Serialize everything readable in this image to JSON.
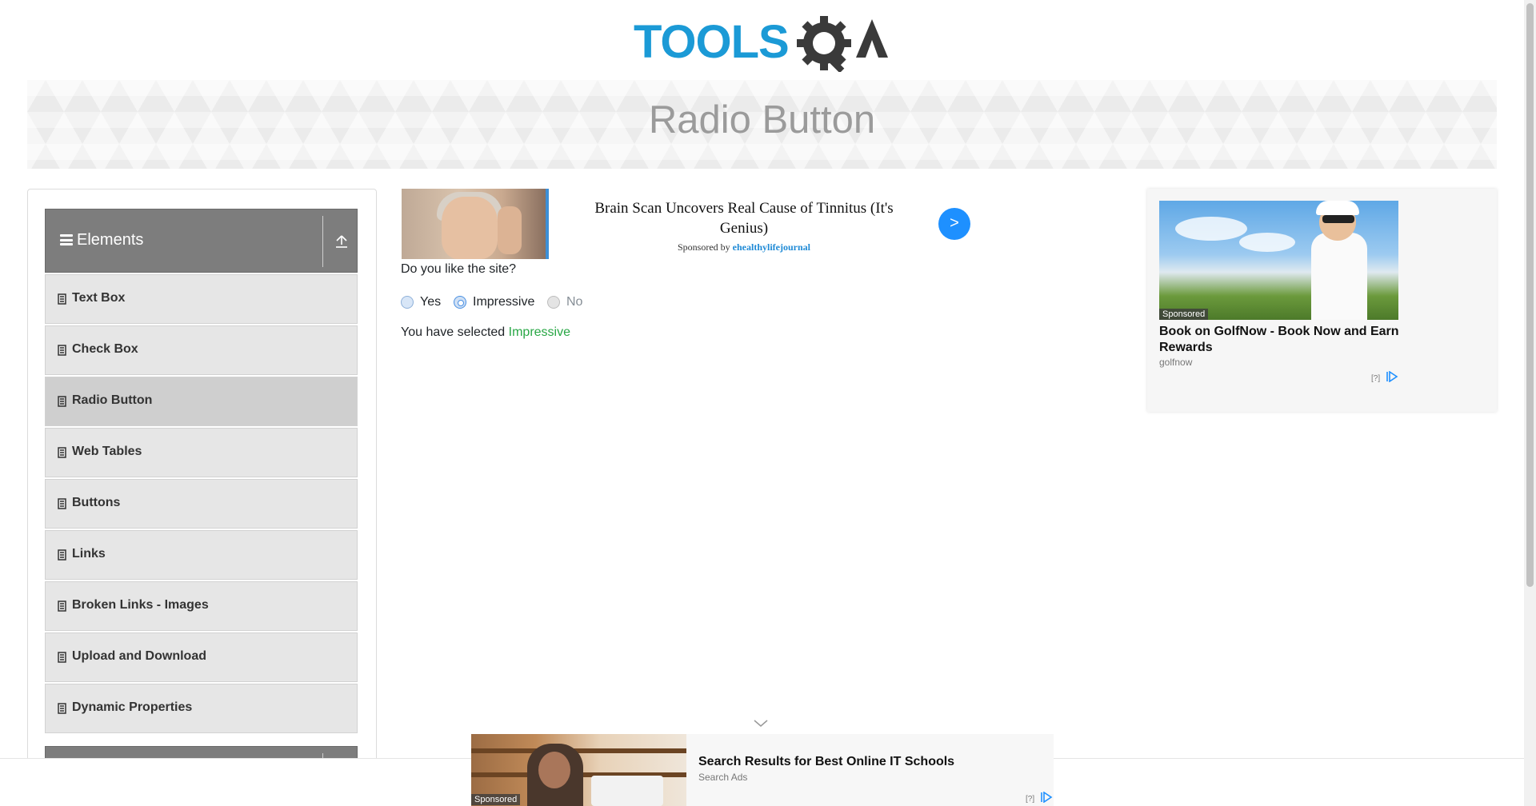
{
  "header": {
    "logo_alt": "TOOLSQA",
    "banner_title": "Radio Button"
  },
  "sidebar": {
    "group_title": "Elements",
    "items": [
      {
        "label": "Text Box"
      },
      {
        "label": "Check Box"
      },
      {
        "label": "Radio Button",
        "active": true
      },
      {
        "label": "Web Tables"
      },
      {
        "label": "Buttons"
      },
      {
        "label": "Links"
      },
      {
        "label": "Broken Links - Images"
      },
      {
        "label": "Upload and Download"
      },
      {
        "label": "Dynamic Properties"
      }
    ]
  },
  "ad_top": {
    "headline": "Brain Scan Uncovers Real Cause of Tinnitus (It's Genius)",
    "sponsored_prefix": "Sponsored by",
    "sponsor": "ehealthylifejournal",
    "next_label": ">"
  },
  "main": {
    "question": "Do you like the site?",
    "radios": [
      {
        "label": "Yes",
        "checked": false,
        "disabled": false
      },
      {
        "label": "Impressive",
        "checked": true,
        "disabled": false
      },
      {
        "label": "No",
        "checked": false,
        "disabled": true
      }
    ],
    "result_prefix": "You have selected",
    "result_value": "Impressive"
  },
  "ad_right": {
    "tag": "Sponsored",
    "title": "Book on GolfNow - Book Now and Earn Rewards",
    "source": "golfnow",
    "help": "[?]"
  },
  "ad_bottom": {
    "tag": "Sponsored",
    "title": "Search Results for Best Online IT Schools",
    "source": "Search Ads",
    "help": "[?]"
  },
  "colors": {
    "accent_blue": "#1e90ff",
    "selected_green": "#28a745",
    "sidebar_header": "#7d7d7d"
  }
}
